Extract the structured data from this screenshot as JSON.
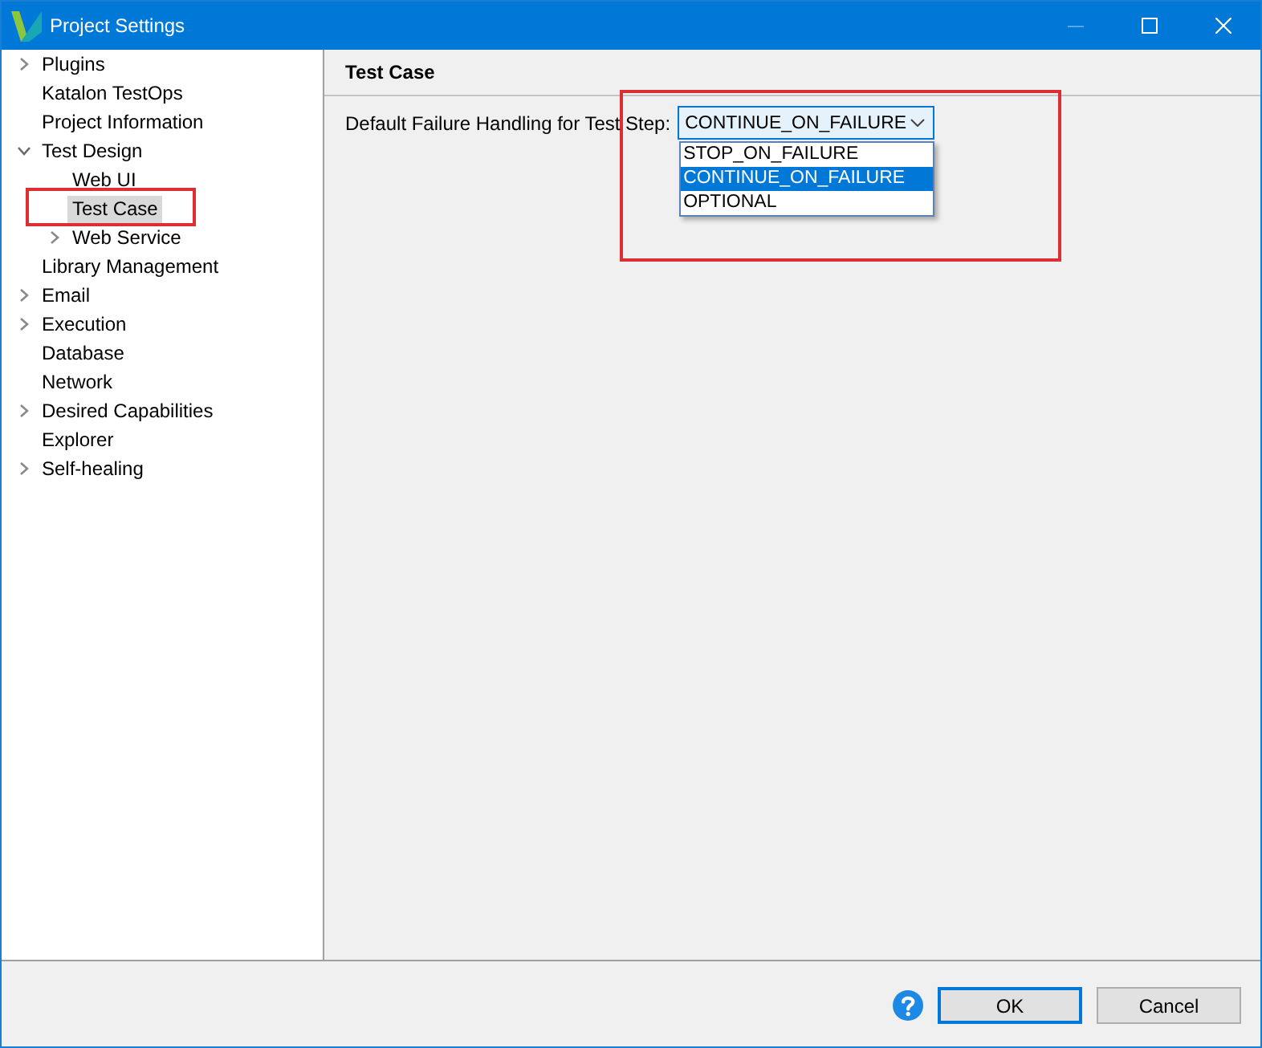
{
  "window": {
    "title": "Project Settings",
    "minimize_disabled": true
  },
  "tree": {
    "items": [
      {
        "label": "Plugins",
        "kind": "branch",
        "expanded": false,
        "selected": false,
        "boxed": false
      },
      {
        "label": "Katalon TestOps",
        "kind": "leaf",
        "selected": false,
        "boxed": false
      },
      {
        "label": "Project Information",
        "kind": "leaf",
        "selected": false,
        "boxed": false
      },
      {
        "label": "Test Design",
        "kind": "branch",
        "expanded": true,
        "selected": false,
        "boxed": false,
        "children": [
          {
            "label": "Web UI",
            "kind": "leaf",
            "selected": false,
            "boxed": false
          },
          {
            "label": "Test Case",
            "kind": "leaf",
            "selected": true,
            "boxed": true
          },
          {
            "label": "Web Service",
            "kind": "branch",
            "expanded": false,
            "selected": false,
            "boxed": false
          }
        ]
      },
      {
        "label": "Library Management",
        "kind": "leaf",
        "selected": false,
        "boxed": false
      },
      {
        "label": "Email",
        "kind": "branch",
        "expanded": false,
        "selected": false,
        "boxed": false
      },
      {
        "label": "Execution",
        "kind": "branch",
        "expanded": false,
        "selected": false,
        "boxed": false
      },
      {
        "label": "Database",
        "kind": "leaf",
        "selected": false,
        "boxed": false
      },
      {
        "label": "Network",
        "kind": "leaf",
        "selected": false,
        "boxed": false
      },
      {
        "label": "Desired Capabilities",
        "kind": "branch",
        "expanded": false,
        "selected": false,
        "boxed": false
      },
      {
        "label": "Explorer",
        "kind": "leaf",
        "selected": false,
        "boxed": false
      },
      {
        "label": "Self-healing",
        "kind": "branch",
        "expanded": false,
        "selected": false,
        "boxed": false
      }
    ]
  },
  "page": {
    "title": "Test Case",
    "boxed": true,
    "fields": [
      {
        "label": "Default Failure Handling for Test Step:",
        "value": "CONTINUE_ON_FAILURE",
        "open": true,
        "options": [
          {
            "label": "STOP_ON_FAILURE",
            "selected": false
          },
          {
            "label": "CONTINUE_ON_FAILURE",
            "selected": true
          },
          {
            "label": "OPTIONAL",
            "selected": false
          }
        ]
      }
    ]
  },
  "footer": {
    "buttons": [
      {
        "label": "OK",
        "default": true
      },
      {
        "label": "Cancel",
        "default": false
      }
    ]
  }
}
